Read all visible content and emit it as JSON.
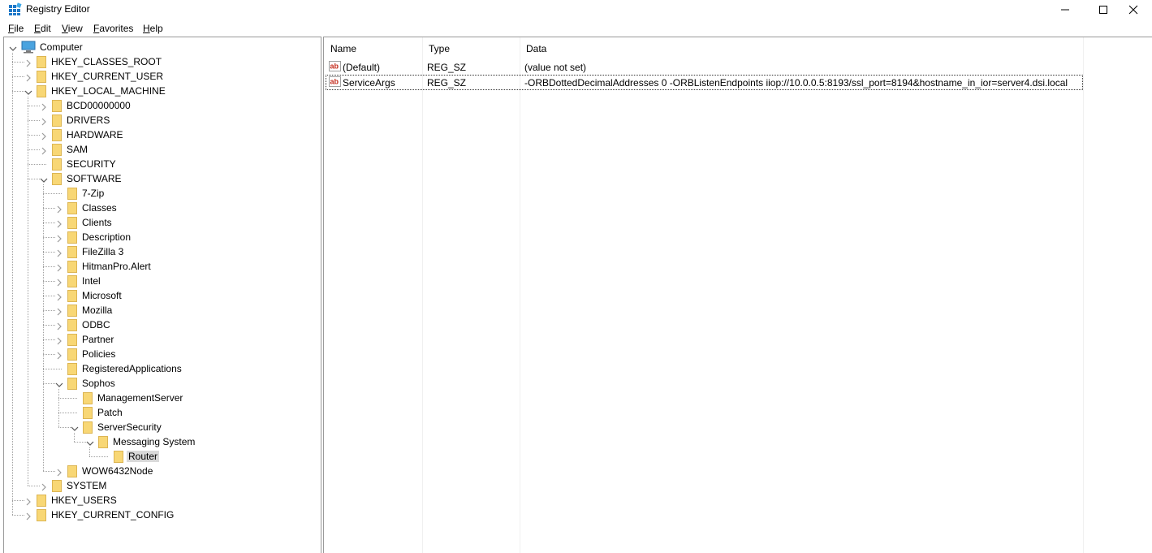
{
  "window": {
    "title": "Registry Editor",
    "controls": [
      "minimize",
      "maximize",
      "close"
    ]
  },
  "menu": [
    {
      "label": "File",
      "u": "F",
      "rest": "ile"
    },
    {
      "label": "Edit",
      "u": "E",
      "rest": "dit"
    },
    {
      "label": "View",
      "u": "V",
      "rest": "iew"
    },
    {
      "label": "Favorites",
      "u": "F",
      "rest": "avorites"
    },
    {
      "label": "Help",
      "u": "H",
      "rest": "elp"
    }
  ],
  "tree": {
    "root": "Computer",
    "nodes": [
      {
        "label": "HKEY_CLASSES_ROOT",
        "level": 1,
        "state": "collapsed"
      },
      {
        "label": "HKEY_CURRENT_USER",
        "level": 1,
        "state": "collapsed"
      },
      {
        "label": "HKEY_LOCAL_MACHINE",
        "level": 1,
        "state": "expanded"
      },
      {
        "label": "BCD00000000",
        "level": 2,
        "state": "collapsed"
      },
      {
        "label": "DRIVERS",
        "level": 2,
        "state": "collapsed"
      },
      {
        "label": "HARDWARE",
        "level": 2,
        "state": "collapsed"
      },
      {
        "label": "SAM",
        "level": 2,
        "state": "collapsed"
      },
      {
        "label": "SECURITY",
        "level": 2,
        "state": "leaf"
      },
      {
        "label": "SOFTWARE",
        "level": 2,
        "state": "expanded"
      },
      {
        "label": "7-Zip",
        "level": 3,
        "state": "leaf"
      },
      {
        "label": "Classes",
        "level": 3,
        "state": "collapsed"
      },
      {
        "label": "Clients",
        "level": 3,
        "state": "collapsed"
      },
      {
        "label": "Description",
        "level": 3,
        "state": "collapsed"
      },
      {
        "label": "FileZilla 3",
        "level": 3,
        "state": "collapsed"
      },
      {
        "label": "HitmanPro.Alert",
        "level": 3,
        "state": "collapsed"
      },
      {
        "label": "Intel",
        "level": 3,
        "state": "collapsed"
      },
      {
        "label": "Microsoft",
        "level": 3,
        "state": "collapsed"
      },
      {
        "label": "Mozilla",
        "level": 3,
        "state": "collapsed"
      },
      {
        "label": "ODBC",
        "level": 3,
        "state": "collapsed"
      },
      {
        "label": "Partner",
        "level": 3,
        "state": "collapsed"
      },
      {
        "label": "Policies",
        "level": 3,
        "state": "collapsed"
      },
      {
        "label": "RegisteredApplications",
        "level": 3,
        "state": "leaf"
      },
      {
        "label": "Sophos",
        "level": 3,
        "state": "expanded"
      },
      {
        "label": "ManagementServer",
        "level": 4,
        "state": "leaf"
      },
      {
        "label": "Patch",
        "level": 4,
        "state": "leaf"
      },
      {
        "label": "ServerSecurity",
        "level": 4,
        "state": "expanded"
      },
      {
        "label": "Messaging System",
        "level": 5,
        "state": "expanded"
      },
      {
        "label": "Router",
        "level": 6,
        "state": "leaf",
        "selected": true
      },
      {
        "label": "WOW6432Node",
        "level": 3,
        "state": "collapsed"
      },
      {
        "label": "SYSTEM",
        "level": 2,
        "state": "collapsed"
      },
      {
        "label": "HKEY_USERS",
        "level": 1,
        "state": "collapsed"
      },
      {
        "label": "HKEY_CURRENT_CONFIG",
        "level": 1,
        "state": "collapsed"
      }
    ]
  },
  "list": {
    "columns": [
      "Name",
      "Type",
      "Data"
    ],
    "rows": [
      {
        "name": "(Default)",
        "type": "REG_SZ",
        "data": "(value not set)",
        "focused": false
      },
      {
        "name": "ServiceArgs",
        "type": "REG_SZ",
        "data": "-ORBDottedDecimalAddresses 0 -ORBListenEndpoints iiop://10.0.0.5:8193/ssl_port=8194&hostname_in_ior=server4.dsi.local",
        "focused": true
      }
    ]
  },
  "colors": {
    "folder_fill": "#f8d775",
    "folder_stroke": "#dcb553",
    "selected_bg": "#d9d9d9",
    "pane_border": "#9a9a9a",
    "icon_red": "#c42b1c"
  }
}
